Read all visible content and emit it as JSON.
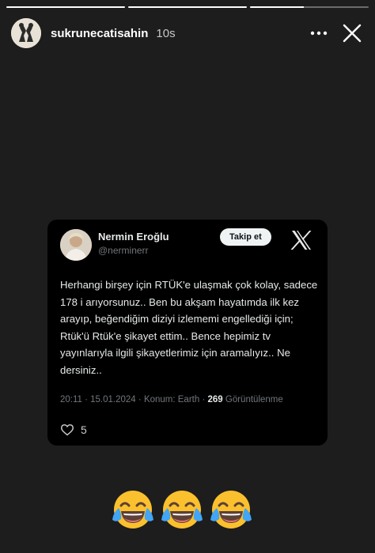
{
  "story": {
    "username": "sukrunecatisahin",
    "time_ago": "10s",
    "progress": [
      1,
      1,
      0.45
    ]
  },
  "tweet": {
    "name": "Nermin Eroğlu",
    "handle": "@nerminerr",
    "follow_label": "Takip et",
    "body": "Herhangi birşey için RTÜK'e ulaşmak  çok kolay, sadece 178 i arıyorsunuz.. Ben bu akşam hayatımda ilk kez arayıp, beğendiğim diziyi izlememi engellediği için; Rtük'ü Rtük'e şikayet ettim.. Bence hepimiz tv yayınlarıyla ilgili şikayetlerimiz için aramalıyız.. Ne dersiniz..",
    "meta": {
      "datetime": "20:11 · 15.01.2024",
      "location": "Konum: Earth",
      "views_count": "269",
      "views_label": "Görüntülenme"
    },
    "likes": "5"
  },
  "reactions": [
    "😂",
    "😂",
    "😂"
  ],
  "icons": {
    "more": "more-horizontal-icon",
    "close": "close-icon",
    "x_logo": "x-logo-icon",
    "like": "heart-icon",
    "emoji": "face-with-tears-of-joy-icon"
  },
  "colors": {
    "background": "#1d1d1d",
    "tweet_card": "#000000",
    "tweet_text": "#e7e9ea",
    "tweet_secondary": "#71767b",
    "follow_button": "#eff3f4",
    "emoji_face": "#fbc02d",
    "emoji_tears": "#42a5f5"
  }
}
